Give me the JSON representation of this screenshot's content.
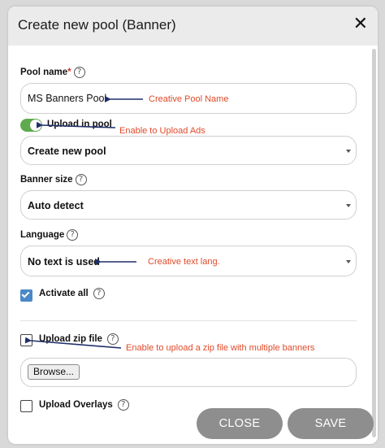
{
  "modal": {
    "title": "Create new pool (Banner)",
    "close_icon": "close-icon"
  },
  "form": {
    "pool_name_label": "Pool name",
    "required_mark": "*",
    "pool_name_value": "MS Banners Pool",
    "upload_in_pool_label": "Upload in pool",
    "upload_in_pool_enabled": true,
    "pool_select_value": "Create new pool",
    "banner_size_label": "Banner size",
    "banner_size_value": "Auto detect",
    "language_label": "Language",
    "language_value": "No text is used",
    "activate_all_label": "Activate all",
    "activate_all_checked": true,
    "upload_zip_label": "Upload zip file",
    "upload_zip_checked": false,
    "browse_label": "Browse...",
    "upload_overlays_label": "Upload Overlays",
    "help_glyph": "?"
  },
  "footer": {
    "close_label": "CLOSE",
    "save_label": "SAVE"
  },
  "annotations": {
    "pool_name_note": "Creative Pool Name",
    "upload_note": "Enable to Upload Ads",
    "language_note": "Creative text lang.",
    "zip_note": "Enable to upload a zip file with multiple banners"
  },
  "colors": {
    "toggle_on": "#5fa94f",
    "checkbox_checked": "#4a88c8",
    "annotation_text": "#e04a2a",
    "annotation_arrow": "#1f2f6b",
    "button_bg": "#8e8e8e"
  }
}
